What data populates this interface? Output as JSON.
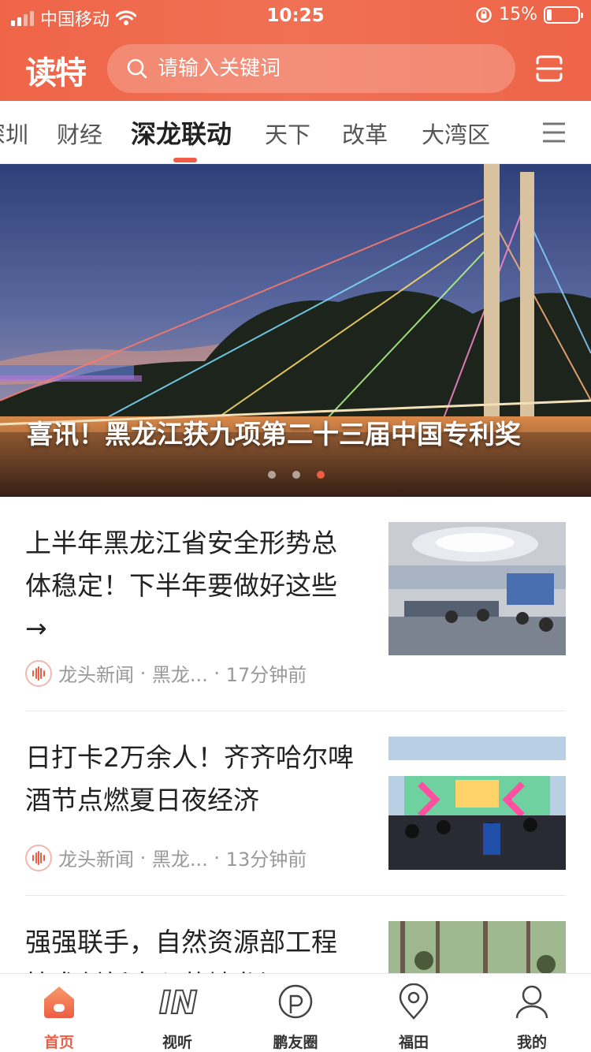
{
  "status_bar": {
    "carrier": "中国移动",
    "time": "10:25",
    "battery": "15%"
  },
  "header": {
    "logo_text": "读特",
    "search_placeholder": "请输入关键词"
  },
  "tabs": {
    "items": [
      "深圳",
      "财经",
      "深龙联动",
      "天下",
      "改革",
      "大湾区"
    ],
    "active": "深龙联动"
  },
  "banner": {
    "title": "喜讯！黑龙江获九项第二十三届中国专利奖",
    "slide_count": 3,
    "active_slide": 3
  },
  "news": [
    {
      "title": "上半年黑龙江省安全形势总体稳定！下半年要做好这些→",
      "source": "龙头新闻",
      "channel": "黑龙...",
      "time": "17分钟前"
    },
    {
      "title": "日打卡2万余人！齐齐哈尔啤酒节点燃夏日夜经济",
      "source": "龙头新闻",
      "channel": "黑龙...",
      "time": "13分钟前"
    },
    {
      "title": "强强联手，自然资源部工程技术创新中心落地龙江"
    }
  ],
  "bottom_nav": {
    "items": [
      "首页",
      "视听",
      "鹏友圈",
      "福田",
      "我的"
    ],
    "active": "首页"
  },
  "colors": {
    "brand": "#ee5d44",
    "header_bg": "#f06a4e"
  }
}
